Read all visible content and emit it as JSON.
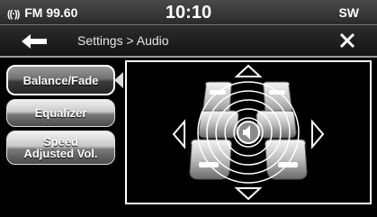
{
  "status_bar": {
    "radio_band": "FM",
    "frequency": "99.60",
    "time": "10:10",
    "compass": "SW"
  },
  "title_bar": {
    "breadcrumb": "Settings > Audio",
    "back_icon": "back-arrow-icon",
    "close_icon": "close-icon"
  },
  "side_menu": {
    "items": [
      {
        "label": "Balance/Fade",
        "active": true
      },
      {
        "label": "Equalizer",
        "active": false
      },
      {
        "label_line1": "Speed",
        "label_line2": "Adjusted Vol.",
        "active": false
      }
    ]
  },
  "balance_fade": {
    "icons": [
      "fade-front-arrow-icon",
      "fade-rear-arrow-icon",
      "balance-left-arrow-icon",
      "balance-right-arrow-icon",
      "speaker-icon",
      "car-seats-icon"
    ],
    "balance": 0,
    "fade": 0
  },
  "colors": {
    "background": "#000000",
    "accent": "#ffffff",
    "button_silver": "#c8c8c8"
  }
}
